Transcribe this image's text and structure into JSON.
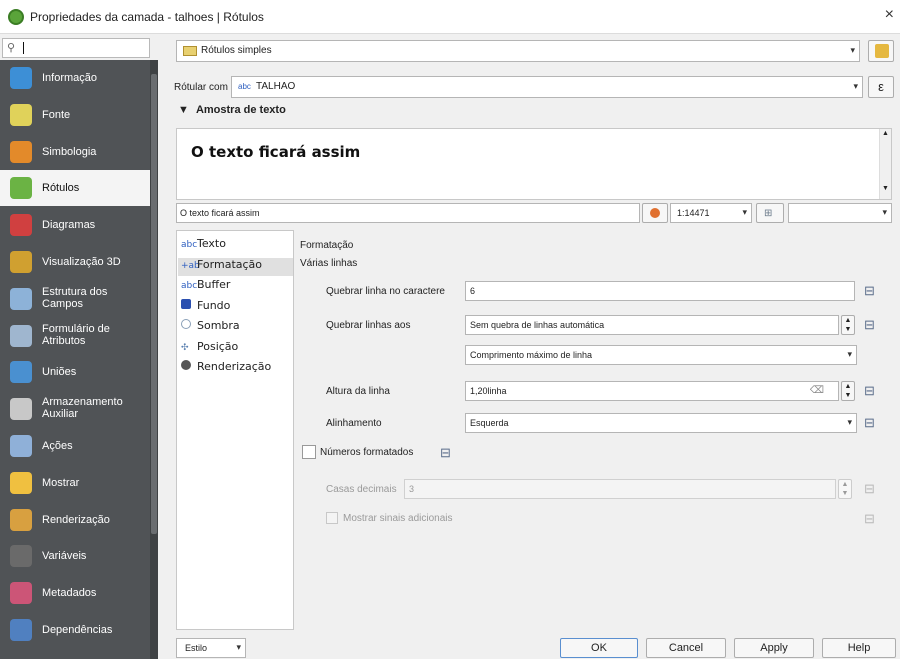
{
  "window": {
    "title": "Propriedades da camada - talhoes | Rótulos",
    "close_glyph": "×"
  },
  "sidebar": {
    "items": [
      {
        "label": "Informação",
        "icon": "info-icon",
        "color": "#3d8fd6"
      },
      {
        "label": "Fonte",
        "icon": "source-icon",
        "color": "#e0d25a"
      },
      {
        "label": "Simbologia",
        "icon": "symbology-icon",
        "color": "#e38a2a"
      },
      {
        "label": "Rótulos",
        "icon": "labels-icon",
        "color": "#6bb344"
      },
      {
        "label": "Diagramas",
        "icon": "diagram-icon",
        "color": "#d04040"
      },
      {
        "label": "Visualização 3D",
        "icon": "cube-icon",
        "color": "#d0a030"
      },
      {
        "label": "Estrutura dos Campos",
        "icon": "fields-icon",
        "color": "#8db2d8"
      },
      {
        "label": "Formulário de Atributos",
        "icon": "form-icon",
        "color": "#9fb6cf"
      },
      {
        "label": "Uniões",
        "icon": "join-icon",
        "color": "#4a90d0"
      },
      {
        "label": "Armazenamento Auxiliar",
        "icon": "storage-icon",
        "color": "#c8c8c8"
      },
      {
        "label": "Ações",
        "icon": "gear-icon",
        "color": "#8fb0d8"
      },
      {
        "label": "Mostrar",
        "icon": "speech-bubble-icon",
        "color": "#f0c040"
      },
      {
        "label": "Renderização",
        "icon": "brush-icon",
        "color": "#d8a040"
      },
      {
        "label": "Variáveis",
        "icon": "variable-icon",
        "color": "#6a6a6a"
      },
      {
        "label": "Metadados",
        "icon": "metadata-icon",
        "color": "#cc5577"
      },
      {
        "label": "Dependências",
        "icon": "dependencies-icon",
        "color": "#5080c0"
      }
    ]
  },
  "top": {
    "mode": "Rótulos simples",
    "label_with_caption": "Rótular com",
    "label_field": "TALHAO",
    "field_prefix": "abc",
    "expr_glyph": "ε"
  },
  "preview": {
    "header": "Amostra de texto",
    "big_text": "O texto ficará assim",
    "input_text": "O texto ficará assim",
    "scale": "1:14471"
  },
  "subtabs": [
    {
      "label": "Texto",
      "icon": "text-icon",
      "glyph": "abc"
    },
    {
      "label": "Formatação",
      "icon": "formatting-icon",
      "glyph": "+ab"
    },
    {
      "label": "Buffer",
      "icon": "buffer-icon",
      "glyph": "abc"
    },
    {
      "label": "Fundo",
      "icon": "background-icon",
      "glyph": ""
    },
    {
      "label": "Sombra",
      "icon": "shadow-icon",
      "glyph": ""
    },
    {
      "label": "Posição",
      "icon": "position-icon",
      "glyph": "✣"
    },
    {
      "label": "Renderização",
      "icon": "render-icon",
      "glyph": ""
    }
  ],
  "formatting": {
    "section": "Formatação",
    "multiline": "Várias linhas",
    "wrap_char_label": "Quebrar linha no caractere",
    "wrap_char_value": "6",
    "wrap_lines_label": "Quebrar linhas aos",
    "wrap_lines_value": "Sem quebra de linhas automática",
    "wrap_mode_value": "Comprimento máximo de linha",
    "line_height_label": "Altura da linha",
    "line_height_value": "1,20linha",
    "alignment_label": "Alinhamento",
    "alignment_value": "Esquerda",
    "formatted_numbers_label": "Números formatados",
    "decimals_label": "Casas decimais",
    "decimals_value": "3",
    "show_plus_label": "Mostrar sinais adicionais"
  },
  "footer": {
    "style_label": "Estilo",
    "ok": "OK",
    "cancel": "Cancel",
    "apply": "Apply",
    "help": "Help"
  }
}
